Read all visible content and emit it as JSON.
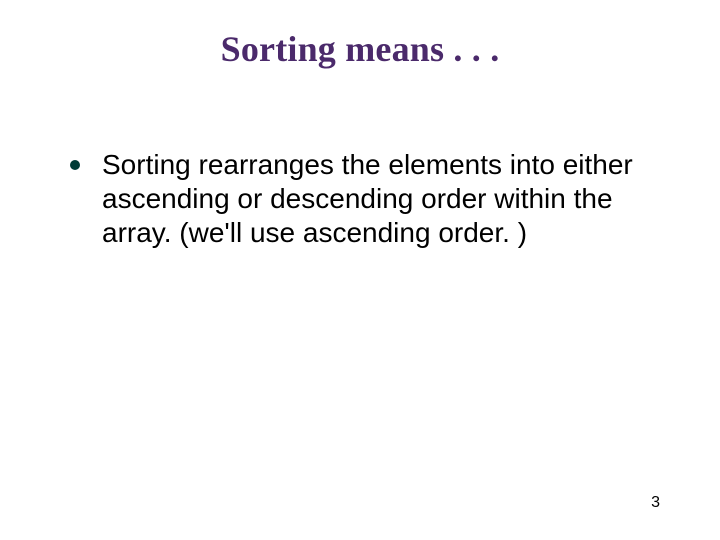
{
  "slide": {
    "title": "Sorting means . . .",
    "bullets": [
      "Sorting rearranges the elements into either ascending or descending order within the array. (we'll use ascending order. )"
    ],
    "page_number": "3"
  }
}
